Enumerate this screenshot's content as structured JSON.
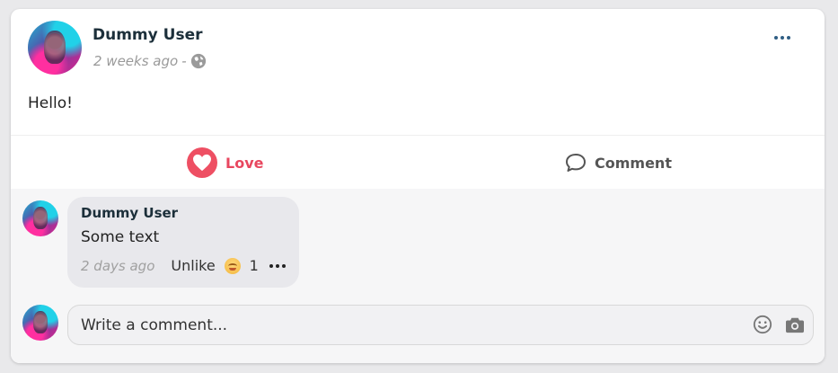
{
  "post": {
    "author": "Dummy User",
    "time": "2 weeks ago",
    "separator": "-",
    "visibility_icon": "globe-icon",
    "text": "Hello!",
    "menu_icon": "more-horizontal-icon"
  },
  "actions": {
    "love_label": "Love",
    "comment_label": "Comment"
  },
  "comments": [
    {
      "author": "Dummy User",
      "text": "Some text",
      "time": "2 days ago",
      "unlike_label": "Unlike",
      "reaction_icon": "grin-emoji-icon",
      "reaction_count": "1"
    }
  ],
  "composer": {
    "placeholder": "Write a comment..."
  },
  "colors": {
    "love": "#e8475f",
    "name": "#1c2f3a",
    "menu_dots": "#2f5e84"
  }
}
